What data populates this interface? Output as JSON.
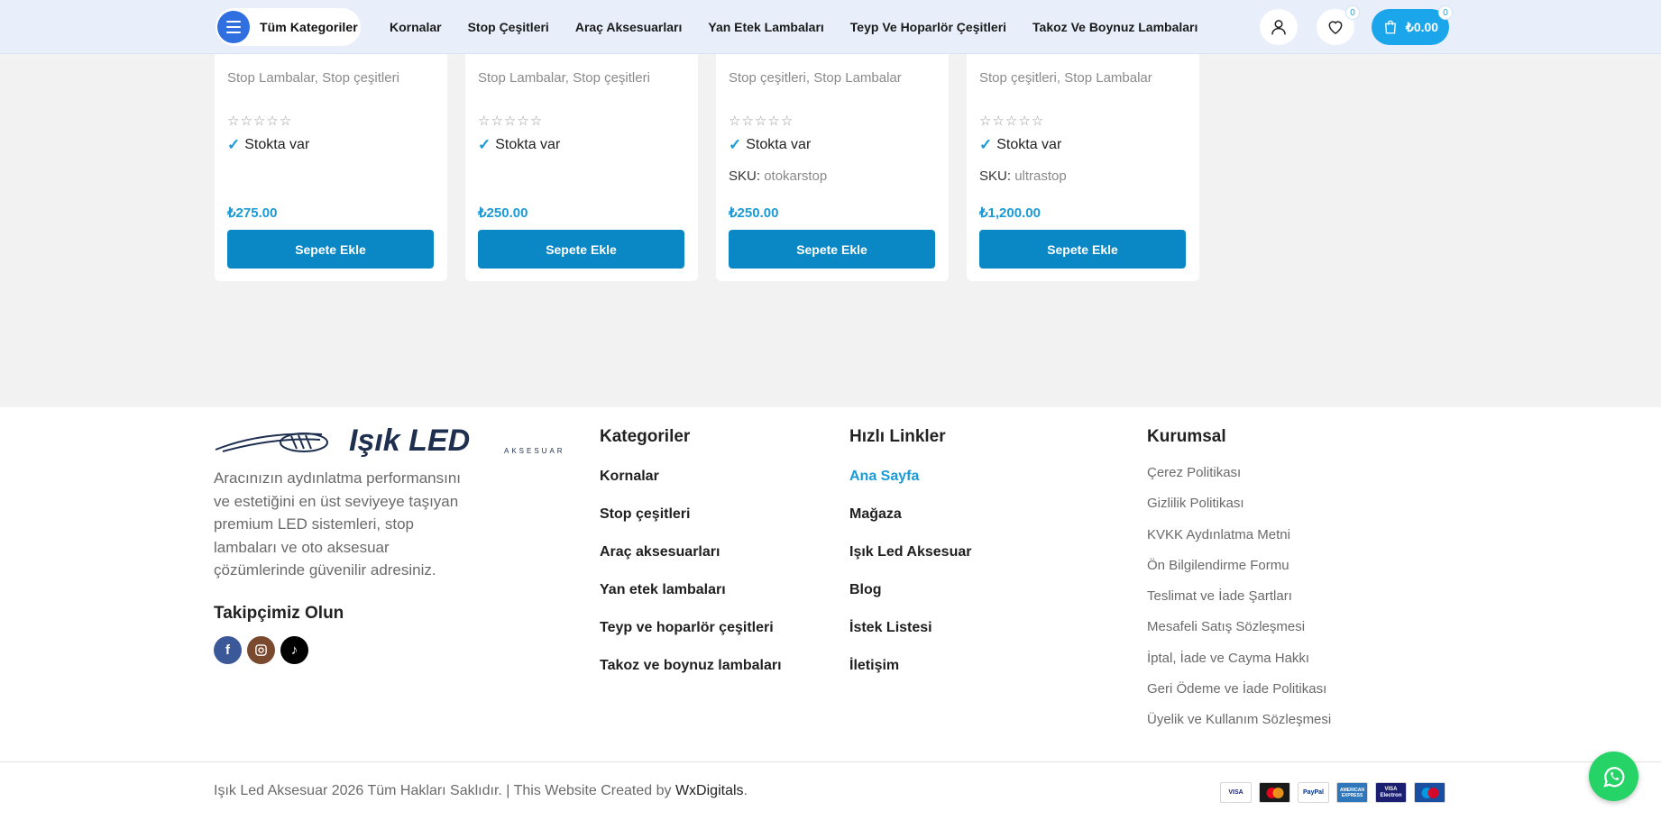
{
  "header": {
    "categories_button": "Tüm Kategoriler",
    "nav": [
      "Kornalar",
      "Stop Çeşitleri",
      "Araç Aksesuarları",
      "Yan Etek Lambaları",
      "Teyp Ve Hoparlör Çeşitleri",
      "Takoz Ve Boynuz Lambaları"
    ],
    "wishlist_count": "0",
    "cart_count": "0",
    "cart_total": "₺0.00",
    "icons": [
      "menu-icon",
      "user-icon",
      "heart-icon",
      "shopping-bag-icon"
    ]
  },
  "products": [
    {
      "categories": "Stop Lambalar, Stop çeşitleri",
      "stock": "Stokta var",
      "sku_label": "",
      "sku": "",
      "price": "₺275.00",
      "button": "Sepete Ekle"
    },
    {
      "categories": "Stop Lambalar, Stop çeşitleri",
      "stock": "Stokta var",
      "sku_label": "",
      "sku": "",
      "price": "₺250.00",
      "button": "Sepete Ekle"
    },
    {
      "categories": "Stop çeşitleri, Stop Lambalar",
      "stock": "Stokta var",
      "sku_label": "SKU:",
      "sku": "otokarstop",
      "price": "₺250.00",
      "button": "Sepete Ekle"
    },
    {
      "categories": "Stop çeşitleri, Stop Lambalar",
      "stock": "Stokta var",
      "sku_label": "SKU:",
      "sku": "ultrastop",
      "price": "₺1,200.00",
      "button": "Sepete Ekle"
    }
  ],
  "footer": {
    "logo_text": "Işık LED",
    "logo_sub": "AKSESUAR",
    "about": "Aracınızın aydınlatma performansını ve estetiğini en üst seviyeye taşıyan premium LED sistemleri, stop lambaları ve oto aksesuar çözümlerinde güvenilir adresiniz.",
    "follow_title": "Takipçimiz Olun",
    "categories_title": "Kategoriler",
    "categories": [
      "Kornalar",
      "Stop çeşitleri",
      "Araç aksesuarları",
      "Yan etek lambaları",
      "Teyp ve hoparlör çeşitleri",
      "Takoz ve boynuz lambaları"
    ],
    "quick_title": "Hızlı Linkler",
    "quick_links": [
      "Ana Sayfa",
      "Mağaza",
      "Işık Led Aksesuar",
      "Blog",
      "İstek Listesi",
      "İletişim"
    ],
    "corporate_title": "Kurumsal",
    "corporate_links": [
      "Çerez Politikası",
      "Gizlilik Politikası",
      "KVKK Aydınlatma Metni",
      "Ön Bilgilendirme Formu",
      "Teslimat ve İade Şartları",
      "Mesafeli Satış Sözleşmesi",
      "İptal, İade ve Cayma Hakkı",
      "Geri Ödeme ve İade Politikası",
      "Üyelik ve Kullanım Sözleşmesi"
    ],
    "copyright": "Işık Led Aksesuar 2026 Tüm Hakları Saklıdır. | This Website Created by ",
    "copyright_link": "WxDigitals",
    "copyright_end": ".",
    "payments": [
      "VISA",
      "MasterCard",
      "PayPal",
      "AMERICAN EXPRESS",
      "VISA Electron",
      "Maestro"
    ]
  },
  "colors": {
    "accent": "#1a9ad6",
    "button": "#0a88c5",
    "header_bg": "#e8effa",
    "whatsapp": "#25d366"
  }
}
